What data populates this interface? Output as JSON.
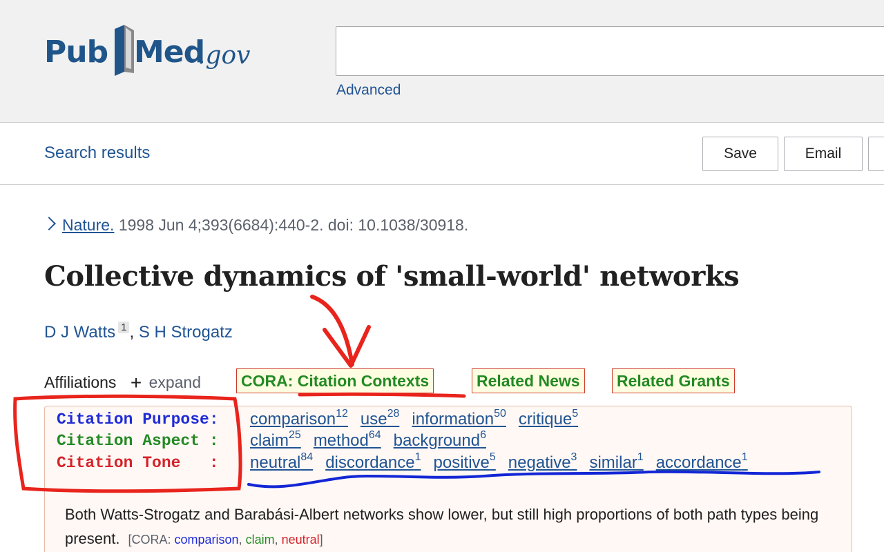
{
  "logo": {
    "pub": "Pub",
    "med": "Med",
    "gov": ".gov"
  },
  "search": {
    "value": "",
    "placeholder": "",
    "advanced_label": "Advanced"
  },
  "toolbar": {
    "search_results_label": "Search results",
    "save_label": "Save",
    "email_label": "Email"
  },
  "article": {
    "journal": "Nature.",
    "citation": "1998 Jun 4;393(6684):440-2. doi: 10.1038/30918.",
    "title": "Collective dynamics of 'small-world' networks",
    "authors": [
      {
        "name": "D J Watts",
        "affiliation": "1"
      },
      {
        "name": "S H Strogatz"
      }
    ],
    "author_separator": ",",
    "affiliations_label": "Affiliations",
    "expand_label": "expand"
  },
  "badges": {
    "cora": "CORA: Citation Contexts",
    "news": "Related News",
    "grants": "Related Grants"
  },
  "cora": {
    "purpose_label": "Citation Purpose:",
    "aspect_label": "Citation Aspect :",
    "tone_label": "Citation Tone   :",
    "purpose": [
      {
        "label": "comparison",
        "count": "12"
      },
      {
        "label": "use",
        "count": "28"
      },
      {
        "label": "information",
        "count": "50"
      },
      {
        "label": "critique",
        "count": "5"
      }
    ],
    "aspect": [
      {
        "label": "claim",
        "count": "25"
      },
      {
        "label": "method",
        "count": "64"
      },
      {
        "label": "background",
        "count": "6"
      }
    ],
    "tone": [
      {
        "label": "neutral",
        "count": "84"
      },
      {
        "label": "discordance",
        "count": "1"
      },
      {
        "label": "positive",
        "count": "5"
      },
      {
        "label": "negative",
        "count": "3"
      },
      {
        "label": "similar",
        "count": "1"
      },
      {
        "label": "accordance",
        "count": "1"
      }
    ],
    "context_sentence": "Both Watts-Strogatz and Barabási-Albert networks show lower, but still high proportions of both path types being present.",
    "note_open": "[CORA: ",
    "note_purpose": "comparison",
    "note_sep1": ", ",
    "note_aspect": "claim",
    "note_sep2": ", ",
    "note_tone": "neutral",
    "note_close": "]"
  },
  "colors": {
    "link": "#205493",
    "purpose": "#1f2bd6",
    "aspect": "#238a24",
    "tone": "#d4232a",
    "annotation_red": "#e8241c",
    "annotation_blue": "#1326d6"
  }
}
